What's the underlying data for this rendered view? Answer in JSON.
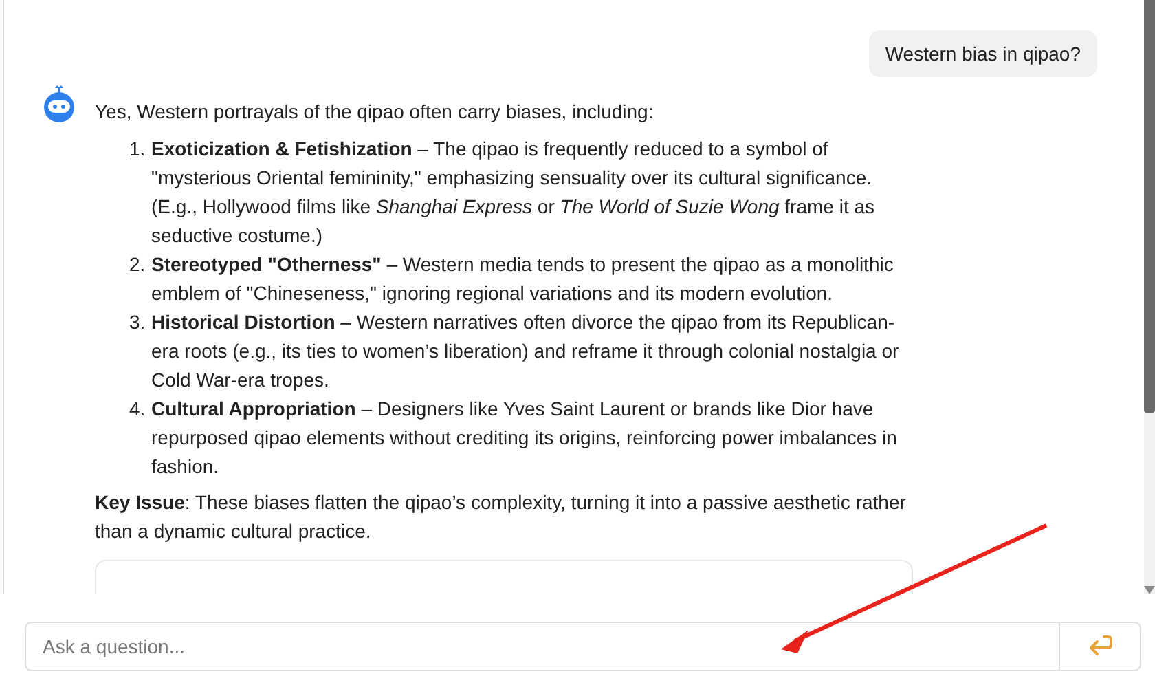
{
  "user_message": "Western bias in qipao?",
  "bot_message": {
    "intro": "Yes, Western portrayals of the qipao often carry biases, including:",
    "items": [
      {
        "number": "1.",
        "title": "Exoticization & Fetishization",
        "text": " – The qipao is frequently reduced to a symbol of \"mysterious Oriental femininity,\" emphasizing sensuality over its cultural significance. (E.g., Hollywood films like *Shanghai Express* or *The World of Suzie Wong* frame it as seductive costume.)"
      },
      {
        "number": "2.",
        "title": "Stereotyped \"Otherness\"",
        "text": " – Western media tends to present the qipao as a monolithic emblem of \"Chineseness,\" ignoring regional variations and its modern evolution."
      },
      {
        "number": "3.",
        "title": "Historical Distortion",
        "text": " – Western narratives often divorce the qipao from its Republican-era roots (e.g., its ties to women’s liberation) and reframe it through colonial nostalgia or Cold War-era tropes."
      },
      {
        "number": "4.",
        "title": "Cultural Appropriation",
        "text": " – Designers like Yves Saint Laurent or brands like Dior have repurposed qipao elements without crediting its origins, reinforcing power imbalances in fashion."
      }
    ],
    "key_issue": {
      "label": "Key Issue",
      "text": ": These biases flatten the qipao’s complexity, turning it into a passive aesthetic rather than a dynamic cultural practice."
    }
  },
  "input": {
    "placeholder": "Ask a question..."
  }
}
